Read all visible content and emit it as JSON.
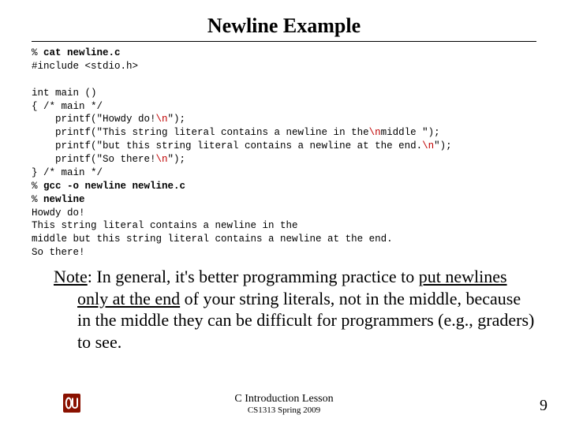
{
  "title": "Newline Example",
  "code": {
    "l1a": "% ",
    "l1b": "cat newline.c",
    "l2": "#include <stdio.h>",
    "l3": "",
    "l4": "int main ()",
    "l5": "{ /* main */",
    "l6a": "    printf(\"Howdy do!",
    "l6b": "\\n",
    "l6c": "\");",
    "l7a": "    printf(\"This string literal contains a newline in the",
    "l7b": "\\n",
    "l7c": "middle \");",
    "l8a": "    printf(\"but this string literal contains a newline at the end.",
    "l8b": "\\n",
    "l8c": "\");",
    "l9a": "    printf(\"So there!",
    "l9b": "\\n",
    "l9c": "\");",
    "l10": "} /* main */",
    "l11a": "% ",
    "l11b": "gcc -o newline newline.c",
    "l12a": "% ",
    "l12b": "newline",
    "l13": "Howdy do!",
    "l14": "This string literal contains a newline in the",
    "l15": "middle but this string literal contains a newline at the end.",
    "l16": "So there!"
  },
  "note": {
    "lead": "Note",
    "t1": ": In general, it's better programming practice to ",
    "u1": "put newlines only at the end",
    "t2": " of your string literals, not in the middle, because in the middle they can be difficult for programmers (e.g., graders) to see."
  },
  "footer": {
    "line1": "C Introduction Lesson",
    "line2": "CS1313 Spring 2009"
  },
  "page_number": "9",
  "logo": {
    "name": "ou-logo-icon",
    "bg": "#ffffff",
    "fg": "#8a1100"
  }
}
